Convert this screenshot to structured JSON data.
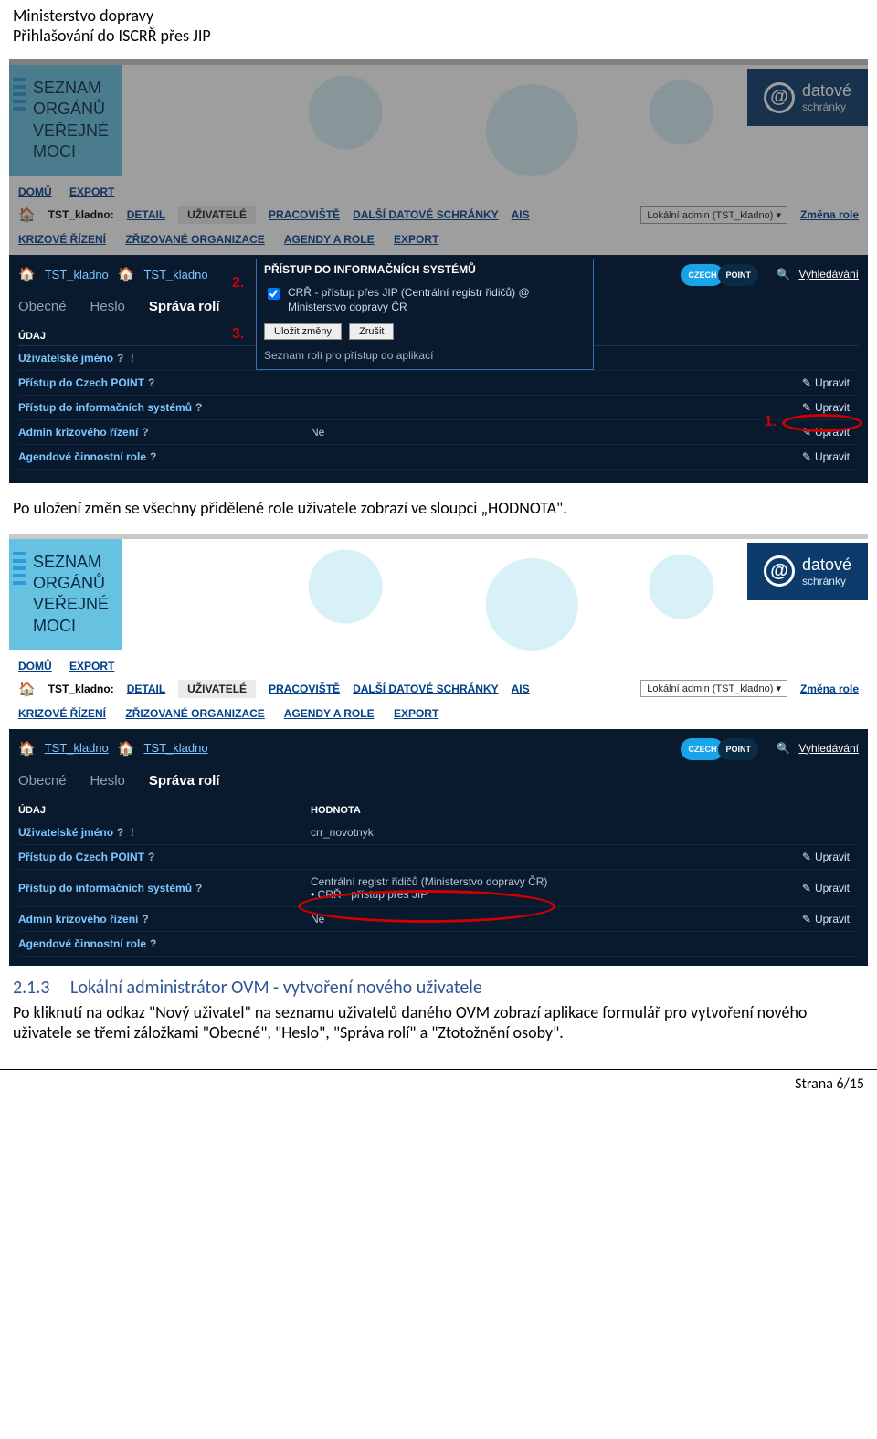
{
  "doc_header": {
    "line1": "Ministerstvo dopravy",
    "line2": "Přihlašování do ISCRŘ přes JIP"
  },
  "doc_footer": {
    "page": "Strana 6/15"
  },
  "body_text_1": "Po uložení změn se všechny přidělené role uživatele zobrazí ve sloupci „HODNOTA\".",
  "section_heading": {
    "num": "2.1.3",
    "title": "Lokální administrátor OVM - vytvoření nového uživatele"
  },
  "body_text_2": "Po kliknutí na odkaz \"Nový uživatel\" na seznamu uživatelů daného OVM zobrazí aplikace formulář pro vytvoření nového uživatele se třemi záložkami \"Obecné\", \"Heslo\", \"Správa rolí\" a \"Ztotožnění osoby\".",
  "common": {
    "logo_block": [
      "SEZNAM",
      "ORGÁNŮ",
      "VEŘEJNÉ",
      "MOCI"
    ],
    "ds_badge_main": "datové",
    "ds_badge_sub": "schránky",
    "topnav": [
      "DOMŮ",
      "EXPORT"
    ],
    "org_name": "TST_kladno:",
    "tabs": [
      "DETAIL",
      "UŽIVATELÉ",
      "PRACOVIŠTĚ",
      "DALŠÍ DATOVÉ SCHRÁNKY",
      "AIS"
    ],
    "active_tab_index": 1,
    "admin_label": "Lokální admin (TST_kladno)",
    "change_role": "Změna role",
    "subrow": [
      "KRIZOVÉ ŘÍZENÍ",
      "ZŘIZOVANÉ ORGANIZACE",
      "AGENDY A ROLE",
      "EXPORT"
    ],
    "crumb_items": [
      "TST_kladno",
      "TST_kladno"
    ],
    "czechpoint": [
      "CZECH",
      "POINT"
    ],
    "search": "Vyhledávání",
    "subtabs": [
      "Obecné",
      "Heslo",
      "Správa rolí"
    ],
    "active_subtab_index": 2,
    "thead": [
      "ÚDAJ",
      "HODNOTA"
    ],
    "edit_label": "Upravit",
    "rows": {
      "username": {
        "label": "Uživatelské jméno",
        "value": "crr_novotnyk"
      },
      "czp": {
        "label": "Přístup do Czech POINT",
        "value": ""
      },
      "is": {
        "label": "Přístup do informačních systémů",
        "value": ""
      },
      "admin": {
        "label": "Admin krizového řízení",
        "value": "Ne"
      },
      "agendy": {
        "label": "Agendové činnostní role",
        "value": ""
      }
    }
  },
  "screenshot1": {
    "popup": {
      "title": "PŘÍSTUP DO INFORMAČNÍCH SYSTÉMŮ",
      "checkbox_label": "CRŘ - přístup přes JIP (Centrální registr řidičů) @ Ministerstvo dopravy ČR",
      "save_btn": "Uložit změny",
      "cancel_btn": "Zrušit",
      "role_list_label": "Seznam rolí pro přístup do aplikací"
    },
    "anno": {
      "n1": "1.",
      "n2": "2.",
      "n3": "3."
    }
  },
  "screenshot2": {
    "is_row_val_line1": "Centrální registr řidičů (Ministerstvo dopravy ČR)",
    "is_row_val_line2": "CRŘ - přístup přes JIP"
  }
}
